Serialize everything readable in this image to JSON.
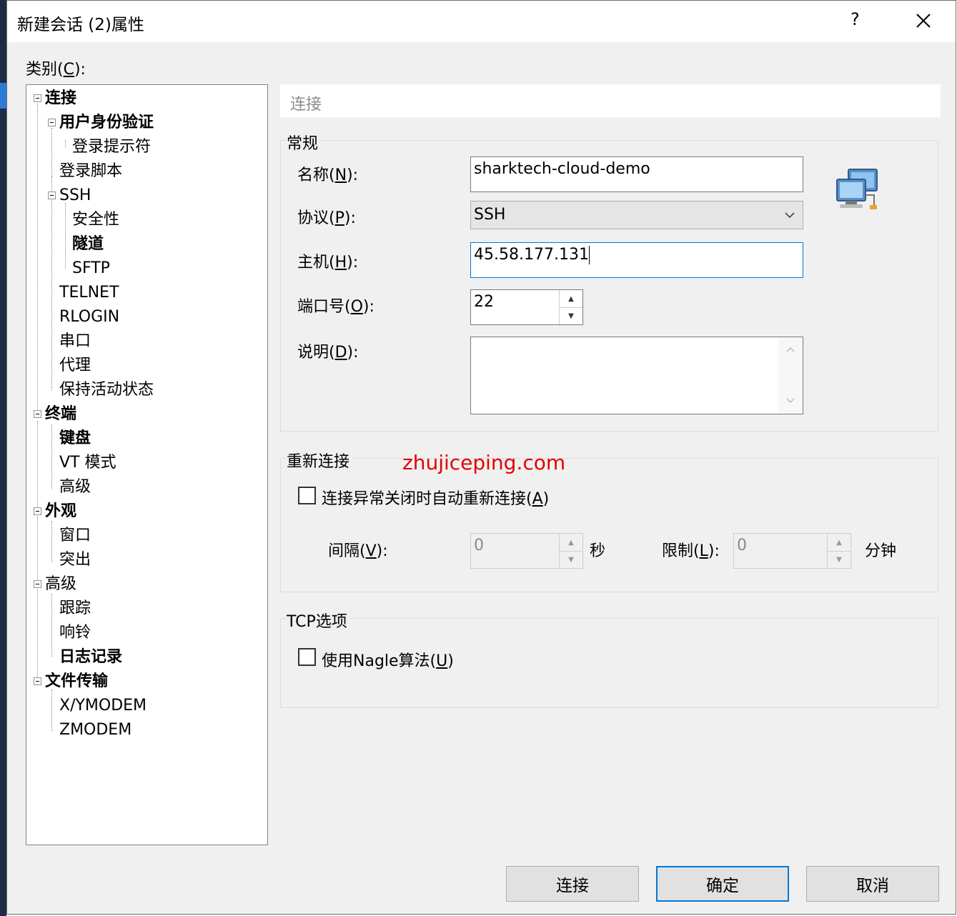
{
  "window": {
    "title": "新建会话 (2)属性",
    "help": "?",
    "close_icon": "close-icon"
  },
  "category_label": {
    "pre": "类别(",
    "key": "C",
    "post": "):"
  },
  "tree": {
    "connection": "连接",
    "auth": "用户身份验证",
    "login_prompt": "登录提示符",
    "login_script": "登录脚本",
    "ssh": "SSH",
    "security": "安全性",
    "tunnel": "隧道",
    "sftp": "SFTP",
    "telnet": "TELNET",
    "rlogin": "RLOGIN",
    "serial": "串口",
    "proxy": "代理",
    "keepalive": "保持活动状态",
    "terminal": "终端",
    "keyboard": "键盘",
    "vt_mode": "VT 模式",
    "advanced_term": "高级",
    "appearance": "外观",
    "window": "窗口",
    "highlight": "突出",
    "advanced": "高级",
    "trace": "跟踪",
    "bell": "响铃",
    "logging": "日志记录",
    "file_transfer": "文件传输",
    "xymodem": "X/YMODEM",
    "zmodem": "ZMODEM"
  },
  "section_title": "连接",
  "general": {
    "group_label": "常规",
    "name_label": {
      "pre": "名称(",
      "key": "N",
      "post": "):"
    },
    "name_value": "sharktech-cloud-demo",
    "protocol_label": {
      "pre": "协议(",
      "key": "P",
      "post": "):"
    },
    "protocol_value": "SSH",
    "host_label": {
      "pre": "主机(",
      "key": "H",
      "post": "):"
    },
    "host_value": "45.58.177.131",
    "port_label": {
      "pre": "端口号(",
      "key": "O",
      "post": "):"
    },
    "port_value": "22",
    "desc_label": {
      "pre": "说明(",
      "key": "D",
      "post": "):"
    },
    "desc_value": ""
  },
  "reconnect": {
    "group_label": "重新连接",
    "auto_reconnect": {
      "pre": "连接异常关闭时自动重新连接(",
      "key": "A",
      "post": ")"
    },
    "interval_label": {
      "pre": "间隔(",
      "key": "V",
      "post": "):"
    },
    "interval_value": "0",
    "interval_unit": "秒",
    "limit_label": {
      "pre": "限制(",
      "key": "L",
      "post": "):"
    },
    "limit_value": "0",
    "limit_unit": "分钟"
  },
  "tcp": {
    "group_label": "TCP选项",
    "nagle": {
      "pre": "使用Nagle算法(",
      "key": "U",
      "post": ")"
    }
  },
  "watermark": "zhujiceping.com",
  "buttons": {
    "connect": "连接",
    "ok": "确定",
    "cancel": "取消"
  }
}
